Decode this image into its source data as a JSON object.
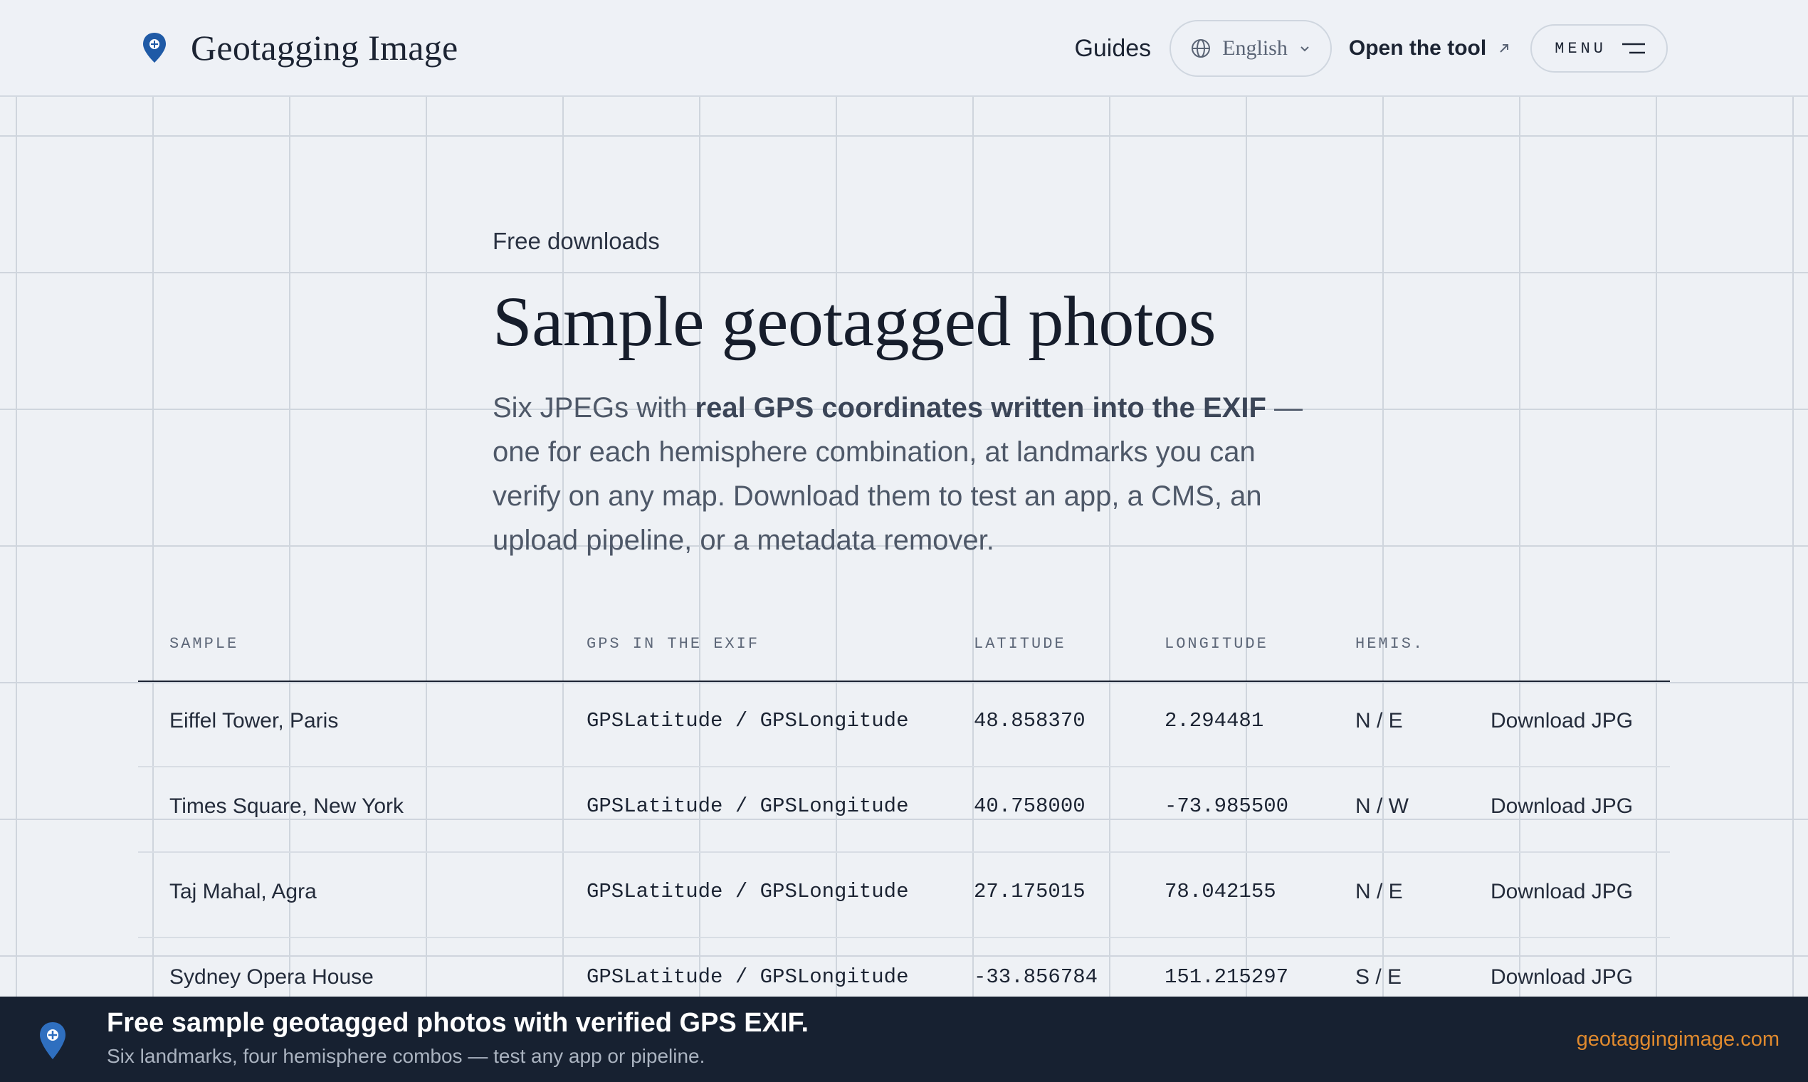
{
  "header": {
    "brand": "Geotagging Image",
    "nav_guides": "Guides",
    "language": "English",
    "open_tool": "Open the tool",
    "menu": "MENU"
  },
  "hero": {
    "eyebrow": "Free downloads",
    "title": "Sample geotagged photos",
    "lede_pre": "Six JPEGs with ",
    "lede_bold": "real GPS coordinates written into the EXIF",
    "lede_post": " — one for each hemisphere combination, at landmarks you can verify on any map. Download them to test an app, a CMS, an upload pipeline, or a metadata remover."
  },
  "table": {
    "columns": [
      "SAMPLE",
      "GPS IN THE EXIF",
      "LATITUDE",
      "LONGITUDE",
      "HEMIS."
    ],
    "rows": [
      {
        "sample": "Eiffel Tower, Paris",
        "gps": "GPSLatitude / GPSLongitude",
        "lat": "48.858370",
        "lon": "2.294481",
        "hemi": "N / E",
        "action": "Download JPG"
      },
      {
        "sample": "Times Square, New York",
        "gps": "GPSLatitude / GPSLongitude",
        "lat": "40.758000",
        "lon": "-73.985500",
        "hemi": "N / W",
        "action": "Download JPG"
      },
      {
        "sample": "Taj Mahal, Agra",
        "gps": "GPSLatitude / GPSLongitude",
        "lat": "27.175015",
        "lon": "78.042155",
        "hemi": "N / E",
        "action": "Download JPG"
      },
      {
        "sample": "Sydney Opera House",
        "gps": "GPSLatitude / GPSLongitude",
        "lat": "-33.856784",
        "lon": "151.215297",
        "hemi": "S / E",
        "action": "Download JPG"
      }
    ]
  },
  "banner": {
    "title": "Free sample geotagged photos with verified GPS EXIF.",
    "subtitle": "Six landmarks, four hemisphere combos — test any app or pipeline.",
    "url": "geotaggingimage.com"
  },
  "colors": {
    "background": "#eef1f5",
    "brand_pin": "#1f5aa6",
    "banner_bg": "#172131",
    "url_accent": "#e08a2e"
  }
}
